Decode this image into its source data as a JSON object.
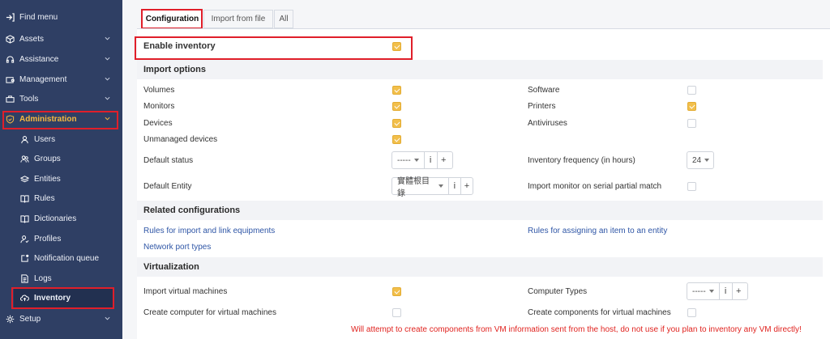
{
  "sidebar": {
    "items": [
      {
        "label": "Find menu",
        "icon": "find-menu-icon"
      },
      {
        "label": "Assets",
        "icon": "cube-icon"
      },
      {
        "label": "Assistance",
        "icon": "headset-icon"
      },
      {
        "label": "Management",
        "icon": "wallet-icon"
      },
      {
        "label": "Tools",
        "icon": "briefcase-icon"
      },
      {
        "label": "Administration",
        "icon": "shield-check-icon"
      },
      {
        "label": "Users",
        "icon": "user-icon"
      },
      {
        "label": "Groups",
        "icon": "users-icon"
      },
      {
        "label": "Entities",
        "icon": "stack-icon"
      },
      {
        "label": "Rules",
        "icon": "book-icon"
      },
      {
        "label": "Dictionaries",
        "icon": "book-icon"
      },
      {
        "label": "Profiles",
        "icon": "user-check-icon"
      },
      {
        "label": "Notification queue",
        "icon": "notification-icon"
      },
      {
        "label": "Logs",
        "icon": "logs-icon"
      },
      {
        "label": "Inventory",
        "icon": "cloud-upload-icon"
      },
      {
        "label": "Setup",
        "icon": "gear-icon"
      }
    ],
    "colors": {
      "bg": "#2f3f64",
      "accent": "#f5b841"
    }
  },
  "tabs": [
    {
      "label": "Configuration"
    },
    {
      "label": "Import from file"
    },
    {
      "label": "All"
    }
  ],
  "form": {
    "enable_inventory": {
      "label": "Enable inventory",
      "checked": true
    },
    "import_options": {
      "title": "Import options",
      "volumes": {
        "label": "Volumes",
        "checked": true
      },
      "software": {
        "label": "Software",
        "checked": false
      },
      "monitors": {
        "label": "Monitors",
        "checked": true
      },
      "printers": {
        "label": "Printers",
        "checked": true
      },
      "devices": {
        "label": "Devices",
        "checked": true
      },
      "antiviruses": {
        "label": "Antiviruses",
        "checked": false
      },
      "unmanaged_devices": {
        "label": "Unmanaged devices",
        "checked": true
      },
      "default_status": {
        "label": "Default status",
        "value": "-----",
        "info": "i",
        "add": "+"
      },
      "inventory_frequency": {
        "label": "Inventory frequency (in hours)",
        "value": "24"
      },
      "default_entity": {
        "label": "Default Entity",
        "value": "實體根目錄",
        "info": "i",
        "add": "+"
      },
      "import_monitor_serial": {
        "label": "Import monitor on serial partial match",
        "checked": false
      }
    },
    "related": {
      "title": "Related configurations",
      "rules_import": "Rules for import and link equipments",
      "rules_assign": "Rules for assigning an item to an entity",
      "network_port_types": "Network port types"
    },
    "virtualization": {
      "title": "Virtualization",
      "import_vm": {
        "label": "Import virtual machines",
        "checked": true
      },
      "computer_types": {
        "label": "Computer Types",
        "value": "-----",
        "info": "i",
        "add": "+"
      },
      "create_computer_vm": {
        "label": "Create computer for virtual machines",
        "checked": false
      },
      "create_components_vm": {
        "label": "Create components for virtual machines",
        "checked": false
      },
      "warning": "Will attempt to create components from VM information sent from the host, do not use if you plan to inventory any VM directly!"
    }
  },
  "colors": {
    "checked": "#f2bf4b",
    "link": "#2f56a6",
    "warning": "#e0231f",
    "highlight": "#e01f2a"
  }
}
